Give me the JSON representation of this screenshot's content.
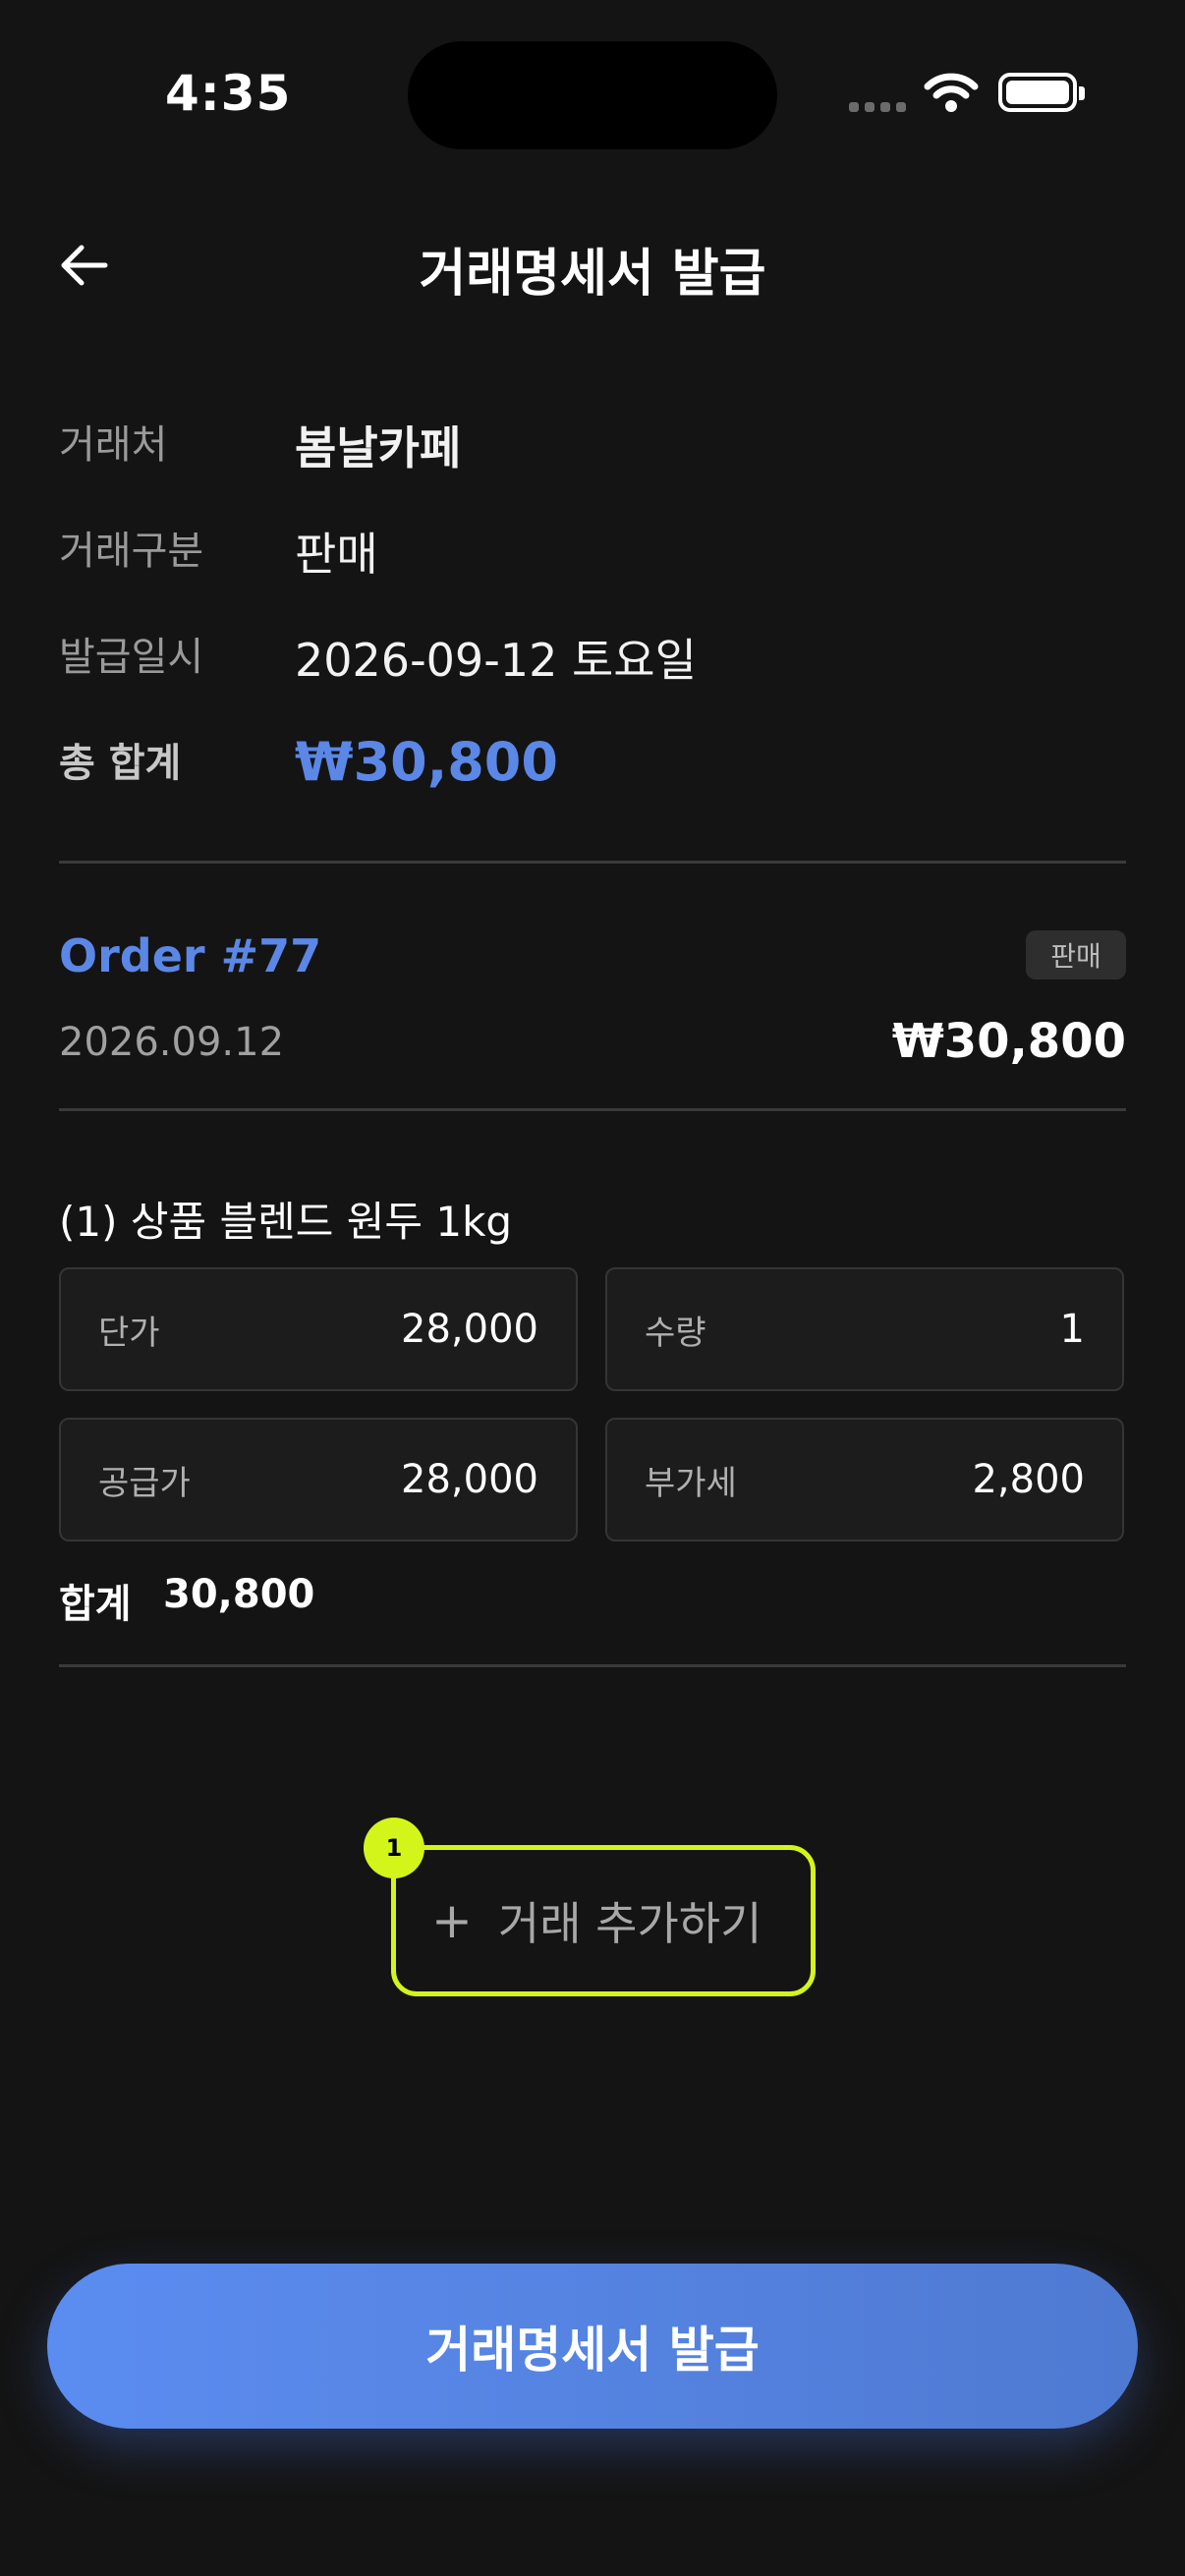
{
  "status_bar": {
    "time": "4:35"
  },
  "header": {
    "title": "거래명세서 발급"
  },
  "info": {
    "partner_label": "거래처",
    "partner_value": "봄날카페",
    "type_label": "거래구분",
    "type_value": "판매",
    "date_label": "발급일시",
    "date_value": "2026-09-12 토요일",
    "total_label": "총 합계",
    "total_value": "₩30,800"
  },
  "order": {
    "title": "Order #77",
    "badge": "판매",
    "date": "2026.09.12",
    "amount": "₩30,800"
  },
  "item": {
    "title": "(1) 상품 블렌드 원두 1kg",
    "unit_price_label": "단가",
    "unit_price": "28,000",
    "qty_label": "수량",
    "qty": "1",
    "supply_label": "공급가",
    "supply": "28,000",
    "vat_label": "부가세",
    "vat": "2,800",
    "sum_label": "합계",
    "sum": "30,800"
  },
  "add_transaction": {
    "icon": "plus-icon",
    "label": "거래 추가하기",
    "marker": "1"
  },
  "issue_button": {
    "label": "거래명세서 발급"
  },
  "colors": {
    "accent": "#5b87e6",
    "highlight": "#d4f51a",
    "background": "#141414"
  }
}
